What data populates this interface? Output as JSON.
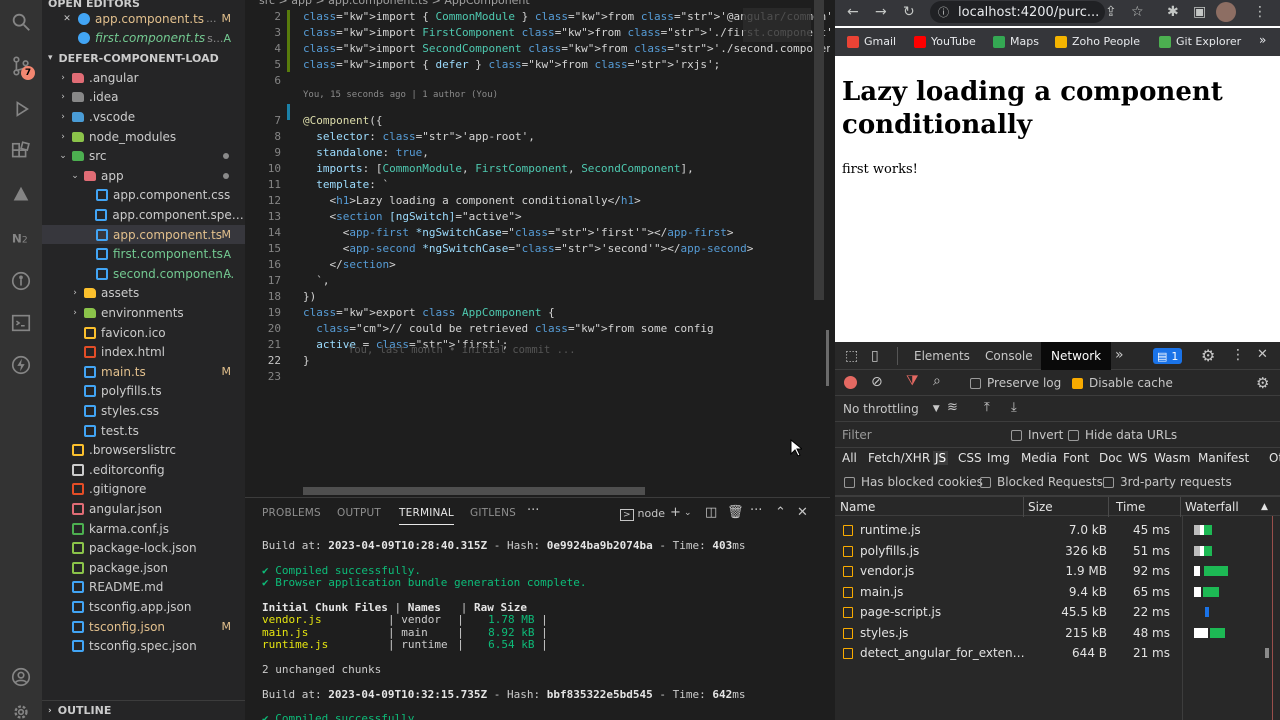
{
  "explorer": {
    "open_editors_title": "OPEN EDITORS",
    "open_editors": [
      {
        "label": "app.component.ts",
        "suffix": "...",
        "status": "M"
      },
      {
        "label": "first.component.ts",
        "suffix": "s...",
        "status": "A"
      }
    ],
    "project_title": "DEFER-COMPONENT-LOAD",
    "tree": [
      {
        "label": ".angular",
        "kind": "folder",
        "depth": 0,
        "color": "#e06c75"
      },
      {
        "label": ".idea",
        "kind": "folder",
        "depth": 0,
        "color": "#888"
      },
      {
        "label": ".vscode",
        "kind": "folder",
        "depth": 0,
        "color": "#4a9cd6"
      },
      {
        "label": "node_modules",
        "kind": "folder",
        "depth": 0,
        "color": "#8bc34a"
      },
      {
        "label": "src",
        "kind": "folder-open",
        "depth": 0,
        "color": "#4caf50"
      },
      {
        "label": "app",
        "kind": "folder-open",
        "depth": 1,
        "color": "#e06c75"
      },
      {
        "label": "app.component.css",
        "kind": "file",
        "depth": 2,
        "color": "#42a5f5"
      },
      {
        "label": "app.component.spec.ts",
        "kind": "file",
        "depth": 2,
        "color": "#42a5f5"
      },
      {
        "label": "app.component.ts",
        "kind": "file",
        "depth": 2,
        "color": "#42a5f5",
        "status": "M",
        "selected": true
      },
      {
        "label": "first.component.ts",
        "kind": "file",
        "depth": 2,
        "color": "#42a5f5",
        "status": "A"
      },
      {
        "label": "second.componen...",
        "kind": "file",
        "depth": 2,
        "color": "#42a5f5",
        "status": "A"
      },
      {
        "label": "assets",
        "kind": "folder",
        "depth": 1,
        "color": "#fbc02d"
      },
      {
        "label": "environments",
        "kind": "folder",
        "depth": 1,
        "color": "#8bc34a"
      },
      {
        "label": "favicon.ico",
        "kind": "file",
        "depth": 1,
        "color": "#fbc02d"
      },
      {
        "label": "index.html",
        "kind": "file",
        "depth": 1,
        "color": "#e44d26"
      },
      {
        "label": "main.ts",
        "kind": "file",
        "depth": 1,
        "color": "#42a5f5",
        "status": "M"
      },
      {
        "label": "polyfills.ts",
        "kind": "file",
        "depth": 1,
        "color": "#42a5f5"
      },
      {
        "label": "styles.css",
        "kind": "file",
        "depth": 1,
        "color": "#42a5f5"
      },
      {
        "label": "test.ts",
        "kind": "file",
        "depth": 1,
        "color": "#42a5f5"
      },
      {
        "label": ".browserslistrc",
        "kind": "file",
        "depth": 0,
        "color": "#fbc02d"
      },
      {
        "label": ".editorconfig",
        "kind": "file",
        "depth": 0,
        "color": "#ccc"
      },
      {
        "label": ".gitignore",
        "kind": "file",
        "depth": 0,
        "color": "#e44d26"
      },
      {
        "label": "angular.json",
        "kind": "file",
        "depth": 0,
        "color": "#e06c75"
      },
      {
        "label": "karma.conf.js",
        "kind": "file",
        "depth": 0,
        "color": "#4caf50"
      },
      {
        "label": "package-lock.json",
        "kind": "file",
        "depth": 0,
        "color": "#8bc34a"
      },
      {
        "label": "package.json",
        "kind": "file",
        "depth": 0,
        "color": "#8bc34a"
      },
      {
        "label": "README.md",
        "kind": "file",
        "depth": 0,
        "color": "#42a5f5"
      },
      {
        "label": "tsconfig.app.json",
        "kind": "file",
        "depth": 0,
        "color": "#42a5f5"
      },
      {
        "label": "tsconfig.json",
        "kind": "file",
        "depth": 0,
        "color": "#42a5f5",
        "status": "M"
      },
      {
        "label": "tsconfig.spec.json",
        "kind": "file",
        "depth": 0,
        "color": "#42a5f5"
      }
    ],
    "outline_title": "OUTLINE"
  },
  "activity": {
    "scm_badge": "7"
  },
  "editor": {
    "breadcrumb": "src > app > app.component.ts > AppComponent",
    "blame": "You, 15 seconds ago | 1 author (You)",
    "inline_blame": "You, last month • initial commit ...",
    "lines": [
      {
        "n": "2",
        "code": "import { CommonModule } from '@angular/common';"
      },
      {
        "n": "3",
        "code": "import FirstComponent from './first.component';"
      },
      {
        "n": "4",
        "code": "import SecondComponent from './second.component';"
      },
      {
        "n": "5",
        "code": "import { defer } from 'rxjs';"
      },
      {
        "n": "6",
        "code": ""
      },
      {
        "n": "7",
        "code": "@Component({"
      },
      {
        "n": "8",
        "code": "  selector: 'app-root',"
      },
      {
        "n": "9",
        "code": "  standalone: true,"
      },
      {
        "n": "10",
        "code": "  imports: [CommonModule, FirstComponent, SecondComponent],"
      },
      {
        "n": "11",
        "code": "  template: `"
      },
      {
        "n": "12",
        "code": "    <h1>Lazy loading a component conditionally</h1>"
      },
      {
        "n": "13",
        "code": "    <section [ngSwitch]=\"active\">"
      },
      {
        "n": "14",
        "code": "      <app-first *ngSwitchCase=\"'first'\"></app-first>"
      },
      {
        "n": "15",
        "code": "      <app-second *ngSwitchCase=\"'second'\"></app-second>"
      },
      {
        "n": "16",
        "code": "    </section>"
      },
      {
        "n": "17",
        "code": "  `,"
      },
      {
        "n": "18",
        "code": "})"
      },
      {
        "n": "19",
        "code": "export class AppComponent {"
      },
      {
        "n": "20",
        "code": "  // could be retrieved from some config"
      },
      {
        "n": "21",
        "code": "  active = 'first';"
      },
      {
        "n": "22",
        "code": "}"
      },
      {
        "n": "23",
        "code": ""
      }
    ]
  },
  "panel": {
    "tabs": [
      "PROBLEMS",
      "OUTPUT",
      "TERMINAL",
      "GITLENS"
    ],
    "active_tab": "TERMINAL",
    "shell": "node",
    "terminal": {
      "build1_prefix": "Build at: ",
      "build1_time": "2023-04-09T10:28:40.315Z",
      "build1_hash_label": " - Hash: ",
      "build1_hash": "0e9924ba9b2074ba",
      "build1_time_label": " - Time: ",
      "build1_ms": "403",
      "ms": "ms",
      "compiled": "✔ Compiled successfully.",
      "bundle": "✔ Browser application bundle generation complete.",
      "h_files": "Initial Chunk Files",
      "h_names": "Names",
      "h_size": "Raw Size",
      "chunks": [
        {
          "file": "vendor.js",
          "name": "vendor",
          "size": "1.78 MB"
        },
        {
          "file": "main.js",
          "name": "main",
          "size": "8.92 kB"
        },
        {
          "file": "runtime.js",
          "name": "runtime",
          "size": "6.54 kB"
        }
      ],
      "unchanged": "2 unchanged chunks",
      "build2_time": "2023-04-09T10:32:15.735Z",
      "build2_hash": "bbf835322e5bd545",
      "build2_ms": "642",
      "compiled2": "✔ Compiled successfully."
    }
  },
  "browser": {
    "url": "localhost:4200/purc...",
    "bookmarks": [
      {
        "label": "Gmail",
        "color": "#ea4335"
      },
      {
        "label": "YouTube",
        "color": "#ff0000"
      },
      {
        "label": "Maps",
        "color": "#34a853"
      },
      {
        "label": "Zoho People",
        "color": "#f4b400"
      },
      {
        "label": "Git Explorer",
        "color": "#4caf50"
      }
    ],
    "heading": "Lazy loading a component conditionally",
    "body": "first works!"
  },
  "devtools": {
    "tabs": [
      "Elements",
      "Console",
      "Network"
    ],
    "active": "Network",
    "issues_count": "1",
    "preserve_log": "Preserve log",
    "disable_cache": "Disable cache",
    "throttling": "No throttling",
    "filter_placeholder": "Filter",
    "invert": "Invert",
    "hide_data": "Hide data URLs",
    "types": [
      "All",
      "Fetch/XHR",
      "JS",
      "CSS",
      "Img",
      "Media",
      "Font",
      "Doc",
      "WS",
      "Wasm",
      "Manifest",
      "Other"
    ],
    "active_type": "JS",
    "blocked_cookies": "Has blocked cookies",
    "blocked_requests": "Blocked Requests",
    "third_party": "3rd-party requests",
    "columns": {
      "name": "Name",
      "size": "Size",
      "time": "Time",
      "waterfall": "Waterfall"
    },
    "rows": [
      {
        "name": "runtime.js",
        "size": "7.0 kB",
        "time": "45 ms"
      },
      {
        "name": "polyfills.js",
        "size": "326 kB",
        "time": "51 ms"
      },
      {
        "name": "vendor.js",
        "size": "1.9 MB",
        "time": "92 ms"
      },
      {
        "name": "main.js",
        "size": "9.4 kB",
        "time": "65 ms"
      },
      {
        "name": "page-script.js",
        "size": "45.5 kB",
        "time": "22 ms"
      },
      {
        "name": "styles.js",
        "size": "215 kB",
        "time": "48 ms"
      },
      {
        "name": "detect_angular_for_extensi...",
        "size": "644 B",
        "time": "21 ms"
      }
    ]
  }
}
